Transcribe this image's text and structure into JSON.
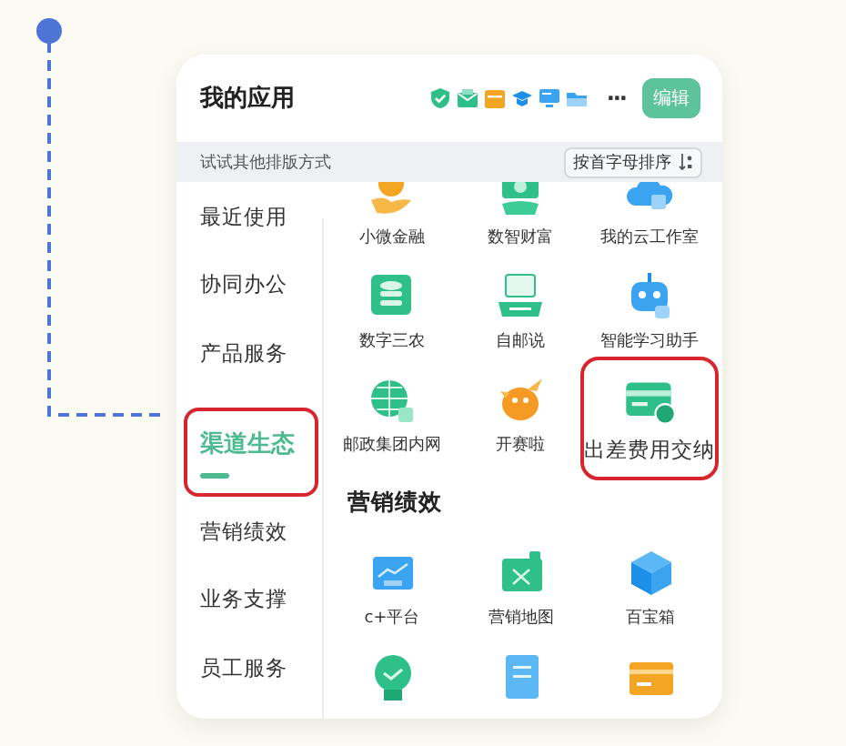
{
  "header": {
    "title": "我的应用",
    "more": "···",
    "edit_button": "编辑"
  },
  "layout_bar": {
    "hint": "试试其他排版方式",
    "sort_button": "按首字母排序"
  },
  "sidebar": {
    "items": [
      {
        "label": "最近使用",
        "selected": false,
        "highlighted": false
      },
      {
        "label": "协同办公",
        "selected": false,
        "highlighted": false
      },
      {
        "label": "产品服务",
        "selected": false,
        "highlighted": false
      },
      {
        "label": "渠道生态",
        "selected": true,
        "highlighted": true
      },
      {
        "label": "营销绩效",
        "selected": false,
        "highlighted": false
      },
      {
        "label": "业务支撑",
        "selected": false,
        "highlighted": false
      },
      {
        "label": "员工服务",
        "selected": false,
        "highlighted": false
      }
    ]
  },
  "sections": [
    {
      "apps": [
        {
          "label": "小微金融",
          "highlighted": false
        },
        {
          "label": "数智财富",
          "highlighted": false
        },
        {
          "label": "我的云工作室",
          "highlighted": false
        },
        {
          "label": "数字三农",
          "highlighted": false
        },
        {
          "label": "自邮说",
          "highlighted": false
        },
        {
          "label": "智能学习助手",
          "highlighted": false
        },
        {
          "label": "邮政集团内网",
          "highlighted": false
        },
        {
          "label": "开赛啦",
          "highlighted": false
        },
        {
          "label": "出差费用交纳",
          "highlighted": true
        }
      ]
    },
    {
      "heading": "营销绩效",
      "apps": [
        {
          "label": "c+平台",
          "highlighted": false
        },
        {
          "label": "营销地图",
          "highlighted": false
        },
        {
          "label": "百宝箱",
          "highlighted": false
        },
        {
          "highlighted": false
        },
        {
          "highlighted": false
        },
        {
          "highlighted": false
        }
      ]
    }
  ]
}
